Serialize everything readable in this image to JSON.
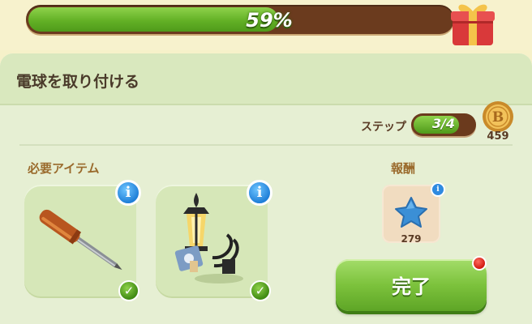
{
  "progress": {
    "percent_text": "59%",
    "value": 0.59
  },
  "task": {
    "title": "電球を取り付ける"
  },
  "steps": {
    "label": "ステップ",
    "text": "3/4",
    "value": 0.75
  },
  "currency": {
    "icon": "coin-b-icon",
    "count": "459"
  },
  "required": {
    "label": "必要アイテム",
    "items": [
      {
        "icon": "screwdriver-icon",
        "completed": true
      },
      {
        "icon": "lantern-icon",
        "completed": true
      }
    ]
  },
  "reward": {
    "label": "報酬",
    "icon": "blue-star-icon",
    "count": "279"
  },
  "buttons": {
    "done_label": "完了"
  },
  "colors": {
    "accent_green": "#63b126",
    "bar_brown": "#6b3b1e",
    "panel": "#e6efd3"
  }
}
